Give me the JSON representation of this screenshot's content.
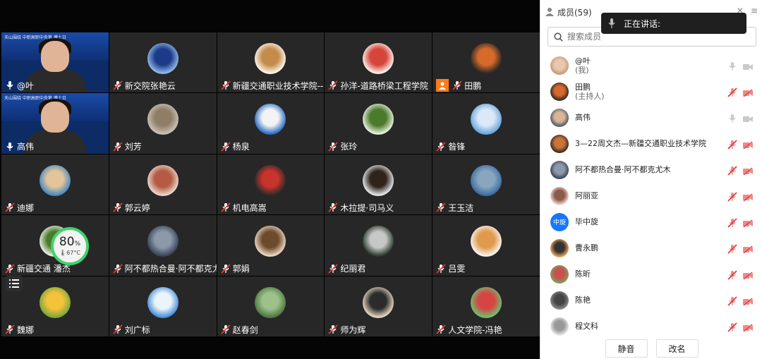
{
  "colors": {
    "host_badge": "#ff7a1a",
    "battery_ring": "#3fd36b",
    "mic_muted": "#e33b3b"
  },
  "battery": {
    "percent": "80",
    "percent_unit": "%",
    "temperature": "67°C"
  },
  "speaking": {
    "label": "正在讲话:"
  },
  "tiles": [
    {
      "name": "@叶",
      "icon": "mic-on-icon",
      "type": "camera",
      "avatar": [
        "#0d2c66",
        "#e0b496"
      ]
    },
    {
      "name": "新交院张艳云",
      "icon": "mic-off-icon",
      "avatar": [
        "#8fb7e6",
        "#1b3a8a"
      ]
    },
    {
      "name": "新疆交通职业技术学院--叶",
      "icon": "mic-off-icon",
      "avatar": [
        "#fbf5e9",
        "#c48b4b"
      ]
    },
    {
      "name": "孙洋-道路桥梁工程学院",
      "icon": "mic-off-icon",
      "avatar": [
        "#f8f1ec",
        "#d6453a"
      ]
    },
    {
      "name": "田鹏",
      "icon": "mic-off-icon",
      "host": true,
      "avatar": [
        "#2f2a26",
        "#d66a2b"
      ]
    },
    {
      "name": "高伟",
      "icon": "mic-on-icon",
      "type": "camera",
      "avatar": [
        "#0d2c66",
        "#e0b496"
      ]
    },
    {
      "name": "刘芳",
      "icon": "mic-off-icon",
      "avatar": [
        "#c9c1b5",
        "#8f7d66"
      ]
    },
    {
      "name": "杨泉",
      "icon": "mic-off-icon",
      "avatar": [
        "#2f6fc6",
        "#f3f3f3"
      ]
    },
    {
      "name": "张玲",
      "icon": "mic-off-icon",
      "avatar": [
        "#e7efe0",
        "#4b7a2c"
      ]
    },
    {
      "name": "昝锋",
      "icon": "mic-off-icon",
      "avatar": [
        "#6aa7dc",
        "#dbe9f6"
      ]
    },
    {
      "name": "迪娜",
      "icon": "mic-off-icon",
      "avatar": [
        "#4a8bbf",
        "#e4c59b"
      ]
    },
    {
      "name": "郭云婷",
      "icon": "mic-off-icon",
      "avatar": [
        "#e8d7cc",
        "#b55a43"
      ]
    },
    {
      "name": "机电高嵩",
      "icon": "mic-off-icon",
      "avatar": [
        "#2c2c2c",
        "#c8332b"
      ]
    },
    {
      "name": "木拉提·司马义",
      "icon": "mic-off-icon",
      "avatar": [
        "#e5e7ea",
        "#2f241b"
      ]
    },
    {
      "name": "王玉洁",
      "icon": "mic-off-icon",
      "avatar": [
        "#3d6ea5",
        "#8aa6bf"
      ]
    },
    {
      "name": "新疆交通 潘杰",
      "icon": "mic-off-icon",
      "avatar": [
        "#e7efe0",
        "#4b7a2c"
      ]
    },
    {
      "name": "阿不都热合曼·阿不都克尤木",
      "icon": "mic-off-icon",
      "avatar": [
        "#3b4557",
        "#8c99aa"
      ]
    },
    {
      "name": "郭娟",
      "icon": "mic-off-icon",
      "avatar": [
        "#ead6c2",
        "#6c4a2c"
      ]
    },
    {
      "name": "纪丽君",
      "icon": "mic-off-icon",
      "avatar": [
        "#2e3d2e",
        "#c7c7c7"
      ]
    },
    {
      "name": "吕雯",
      "icon": "mic-off-icon",
      "avatar": [
        "#f6f3f0",
        "#e09a4b"
      ]
    },
    {
      "name": "魏娜",
      "icon": "mic-off-icon",
      "avatar": [
        "#7da73e",
        "#f5c23a"
      ]
    },
    {
      "name": "刘广标",
      "icon": "mic-off-icon",
      "avatar": [
        "#4a90d9",
        "#eaf4fb"
      ]
    },
    {
      "name": "赵春剑",
      "icon": "mic-off-icon",
      "avatar": [
        "#4e7a43",
        "#9ec08a"
      ]
    },
    {
      "name": "师为辉",
      "icon": "mic-off-icon",
      "avatar": [
        "#e6d6bf",
        "#2b2b2b"
      ]
    },
    {
      "name": "人文学院-冯艳",
      "icon": "mic-off-icon",
      "avatar": [
        "#6fc06f",
        "#d64444"
      ]
    }
  ],
  "cam_banner": "天山围绕 中职高职中央第 博士日",
  "panel": {
    "title": "成员(59)",
    "search_placeholder": "搜索成员",
    "members": [
      {
        "name": "@叶",
        "sub": "(我)",
        "mic": "on",
        "avatar": [
          "#c89a73",
          "#e7c9b1"
        ]
      },
      {
        "name": "田鹏",
        "sub": "(主持人)",
        "mic": "muted",
        "avatar": [
          "#2f2a26",
          "#d66a2b"
        ]
      },
      {
        "name": "高伟",
        "sub": "",
        "mic": "on",
        "avatar": [
          "#545b67",
          "#d8b596"
        ]
      },
      {
        "name": "3—22周文杰—新疆交通职业技术学院",
        "sub": "",
        "mic": "muted",
        "avatar": [
          "#3f2a1f",
          "#c8753a"
        ]
      },
      {
        "name": "阿不都热合曼·阿不都克尤木",
        "sub": "",
        "mic": "muted",
        "avatar": [
          "#3b4557",
          "#8c99aa"
        ]
      },
      {
        "name": "阿丽亚",
        "sub": "",
        "mic": "muted",
        "avatar": [
          "#f3d7cf",
          "#8a5a4a"
        ]
      },
      {
        "name": "毕中旋",
        "sub": "",
        "mic": "muted",
        "avatar_text": "中旋",
        "avatar": [
          "#1677ff",
          "#1677ff"
        ]
      },
      {
        "name": "曹永鹏",
        "sub": "",
        "mic": "muted",
        "avatar": [
          "#f0a65a",
          "#333"
        ]
      },
      {
        "name": "陈昕",
        "sub": "",
        "mic": "muted",
        "avatar": [
          "#7ba35a",
          "#c85050"
        ]
      },
      {
        "name": "陈艳",
        "sub": "",
        "mic": "muted",
        "avatar": [
          "#8a8a8a",
          "#444"
        ]
      },
      {
        "name": "程文科",
        "sub": "",
        "mic": "muted",
        "avatar": [
          "#e9e9e9",
          "#999"
        ]
      }
    ],
    "mute_all_label": "静音",
    "rename_label": "改名"
  }
}
